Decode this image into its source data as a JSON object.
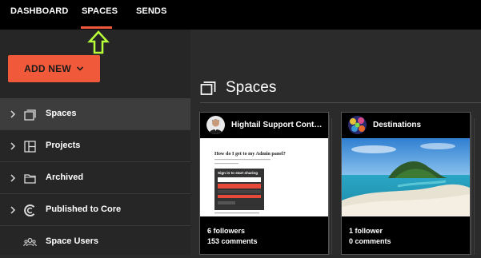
{
  "topnav": {
    "tabs": [
      {
        "label": "DASHBOARD"
      },
      {
        "label": "SPACES"
      },
      {
        "label": "SENDS"
      }
    ],
    "active_tab": "SPACES",
    "accent_color": "#f05a3a"
  },
  "sidebar": {
    "add_new_label": "ADD NEW",
    "items": [
      {
        "label": "Spaces",
        "icon": "spaces-icon"
      },
      {
        "label": "Projects",
        "icon": "projects-icon"
      },
      {
        "label": "Archived",
        "icon": "folder-icon"
      },
      {
        "label": "Published to Core",
        "icon": "core-icon"
      },
      {
        "label": "Space Users",
        "icon": "users-icon"
      }
    ]
  },
  "main": {
    "title": "Spaces",
    "cards": [
      {
        "title": "Hightail Support Content",
        "followers": "6 followers",
        "comments": "153 comments",
        "thumb": {
          "heading": "How do I get to my Admin panel?",
          "panel_title": "Sign in to start sharing"
        }
      },
      {
        "title": "Destinations",
        "followers": "1 follower",
        "comments": "0 comments"
      }
    ]
  }
}
